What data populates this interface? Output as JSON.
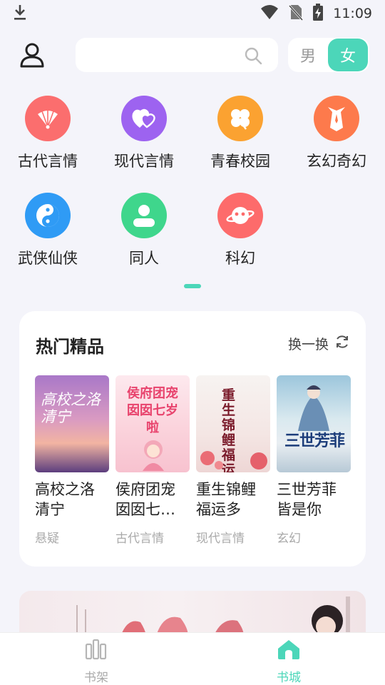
{
  "status_bar": {
    "time": "11:09",
    "icons": [
      "download-icon",
      "wifi-icon",
      "no-sim-icon",
      "battery-charging-icon"
    ]
  },
  "header": {
    "search_placeholder": "",
    "gender_male": "男",
    "gender_female": "女",
    "selected_gender": "女",
    "accent_color": "#4cd6b9"
  },
  "categories": [
    {
      "label": "古代言情",
      "icon": "fan-icon",
      "color": "#fb6e6e"
    },
    {
      "label": "现代言情",
      "icon": "hearts-icon",
      "color": "#9d63f0"
    },
    {
      "label": "青春校园",
      "icon": "clover-icon",
      "color": "#fba231"
    },
    {
      "label": "玄幻奇幻",
      "icon": "tie-icon",
      "color": "#fd7a4c"
    },
    {
      "label": "武侠仙侠",
      "icon": "yin-yang-icon",
      "color": "#2f9bf5"
    },
    {
      "label": "同人",
      "icon": "person-icon",
      "color": "#3fd68c"
    },
    {
      "label": "科幻",
      "icon": "planet-icon",
      "color": "#fd6b6b"
    }
  ],
  "hot": {
    "title": "热门精品",
    "refresh_label": "换一换",
    "books": [
      {
        "name": "高校之洛清宁",
        "genre": "悬疑",
        "cover_text": "高校之洛清宁"
      },
      {
        "name": "侯府团宠囡囡七…",
        "genre": "古代言情",
        "cover_text": "侯府团宠囡囡七岁啦"
      },
      {
        "name": "重生锦鲤福运多",
        "genre": "现代言情",
        "cover_text": "重生锦鲤福运多"
      },
      {
        "name": "三世芳菲皆是你",
        "genre": "玄幻",
        "cover_text": "三世芳菲"
      }
    ]
  },
  "bottom_nav": {
    "items": [
      {
        "label": "书架",
        "icon": "bookshelf-icon",
        "active": false
      },
      {
        "label": "书城",
        "icon": "home-icon",
        "active": true
      }
    ]
  }
}
